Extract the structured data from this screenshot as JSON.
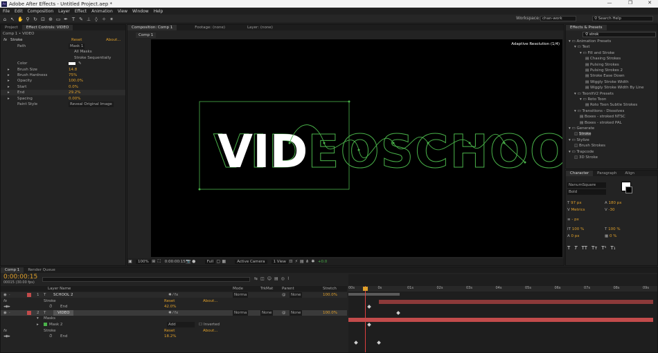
{
  "app": {
    "title": "Adobe After Effects - Untitled Project.aep *",
    "logo": "Ae"
  },
  "menu": [
    "File",
    "Edit",
    "Composition",
    "Layer",
    "Effect",
    "Animation",
    "View",
    "Window",
    "Help"
  ],
  "workspace": {
    "label": "Workspace:",
    "value": "chan-work",
    "search_placeholder": "Search Help"
  },
  "project_panel": {
    "tab": "Project",
    "effect_tab": "Effect Controls: VIDEO",
    "breadcrumb": "Comp 1 • VIDEO",
    "effect": {
      "name": "Stroke",
      "reset": "Reset",
      "about": "About...",
      "rows": [
        {
          "label": "Path",
          "value": "Mask 1"
        },
        {
          "label": "",
          "value": "All Masks"
        },
        {
          "label": "",
          "value": "Stroke Sequentially"
        },
        {
          "label": "Color",
          "value": ""
        },
        {
          "label": "Brush Size",
          "value": "14.8"
        },
        {
          "label": "Brush Hardness",
          "value": "75%"
        },
        {
          "label": "Opacity",
          "value": "100.0%"
        },
        {
          "label": "Start",
          "value": "0.0%"
        },
        {
          "label": "End",
          "value": "29.2%"
        },
        {
          "label": "Spacing",
          "value": "0.00%"
        },
        {
          "label": "Paint Style",
          "value": "Reveal Original Image"
        }
      ]
    }
  },
  "composition": {
    "tab": "Composition: Comp 1",
    "footage_tab": "Footage: (none)",
    "layer_tab": "Layer: (none)",
    "comp_tab": "Comp 1",
    "badge": "Adaptive Resolution (1/4)",
    "text_outline": "VIDEOSCHOOL",
    "text_solid": "VID",
    "bottom": {
      "zoom": "100%",
      "timecode": "0:00:00:15",
      "res": "Full",
      "camera": "Active Camera",
      "view": "1 View",
      "exposure": "+0.0"
    }
  },
  "effects_presets": {
    "tab": "Effects & Presets",
    "search": "strok",
    "items": [
      {
        "label": "Animation Presets",
        "indent": 0,
        "type": "folder"
      },
      {
        "label": "Text",
        "indent": 1,
        "type": "folder"
      },
      {
        "label": "Fill and Stroke",
        "indent": 2,
        "type": "folder"
      },
      {
        "label": "Chasing Strokes",
        "indent": 3,
        "type": "preset"
      },
      {
        "label": "Pulsing Strokes",
        "indent": 3,
        "type": "preset"
      },
      {
        "label": "Pulsing Strokes 2",
        "indent": 3,
        "type": "preset"
      },
      {
        "label": "Stroke Ease Down",
        "indent": 3,
        "type": "preset"
      },
      {
        "label": "Wiggly Stroke Width",
        "indent": 3,
        "type": "preset"
      },
      {
        "label": "Wiggly Stroke Width By Line",
        "indent": 3,
        "type": "preset"
      },
      {
        "label": "ToonItV2 Presets",
        "indent": 1,
        "type": "folder"
      },
      {
        "label": "Roto Toon",
        "indent": 2,
        "type": "folder"
      },
      {
        "label": "Roto Toon Subtle Strokes",
        "indent": 3,
        "type": "preset"
      },
      {
        "label": "Transitions - Dissolves",
        "indent": 1,
        "type": "folder"
      },
      {
        "label": "Boxes - stroked NTSC",
        "indent": 2,
        "type": "preset"
      },
      {
        "label": "Boxes - stroked PAL",
        "indent": 2,
        "type": "preset"
      },
      {
        "label": "Generate",
        "indent": 0,
        "type": "folder"
      },
      {
        "label": "Stroke",
        "indent": 1,
        "type": "effect",
        "selected": true
      },
      {
        "label": "Stylize",
        "indent": 0,
        "type": "folder"
      },
      {
        "label": "Brush Strokes",
        "indent": 1,
        "type": "effect"
      },
      {
        "label": "Trapcode",
        "indent": 0,
        "type": "folder"
      },
      {
        "label": "3D Stroke",
        "indent": 1,
        "type": "effect"
      }
    ]
  },
  "character": {
    "tab": "Character",
    "para_tab": "Paragraph",
    "align_tab": "Align",
    "font": "NanumSquare",
    "style": "Bold",
    "size": "97 px",
    "leading": "180 px",
    "tracking": "-30",
    "kerning": "Metrics",
    "stroke": "- px",
    "vscale": "100 %",
    "hscale": "100 %",
    "baseline": "0 px",
    "tsume": "0 %"
  },
  "timeline": {
    "tab": "Comp 1",
    "render_tab": "Render Queue",
    "timecode": "0:00:00:15",
    "frames": "00015 (30.00 fps)",
    "cols": {
      "layer": "Layer Name",
      "mode": "Mode",
      "trkmat": "TrkMat",
      "parent": "Parent",
      "stretch": "Stretch"
    },
    "rows": [
      {
        "num": "1",
        "name": "SCHOOL 2",
        "mode": "Norma",
        "parent": "None",
        "stretch": "100.0%",
        "type": "layer"
      },
      {
        "name": "Stroke",
        "reset": "Reset",
        "about": "About...",
        "type": "effect"
      },
      {
        "name": "End",
        "value": "42.0%",
        "type": "prop"
      },
      {
        "num": "2",
        "name": "VIDEO",
        "mode": "Norma",
        "trkmat": "None",
        "parent": "None",
        "stretch": "100.0%",
        "type": "layer",
        "selected": true
      },
      {
        "name": "Masks",
        "type": "group"
      },
      {
        "name": "Mask 2",
        "mode": "Add",
        "inverted": "Inverted",
        "type": "mask"
      },
      {
        "name": "Stroke",
        "reset": "Reset",
        "about": "About...",
        "type": "effect"
      },
      {
        "name": "End",
        "value": "18.2%",
        "type": "prop"
      }
    ],
    "ruler": [
      "0s",
      "01s",
      "02s",
      "03s",
      "04s",
      "05s",
      "06s",
      "07s",
      "08s",
      "09s",
      "10s"
    ],
    "ruler_start": "00s"
  },
  "colors": {
    "accent": "#e0a02a",
    "stroke": "#4ab34a",
    "layer_bar": "#c24b4b",
    "selected": "#2d5fa8"
  }
}
